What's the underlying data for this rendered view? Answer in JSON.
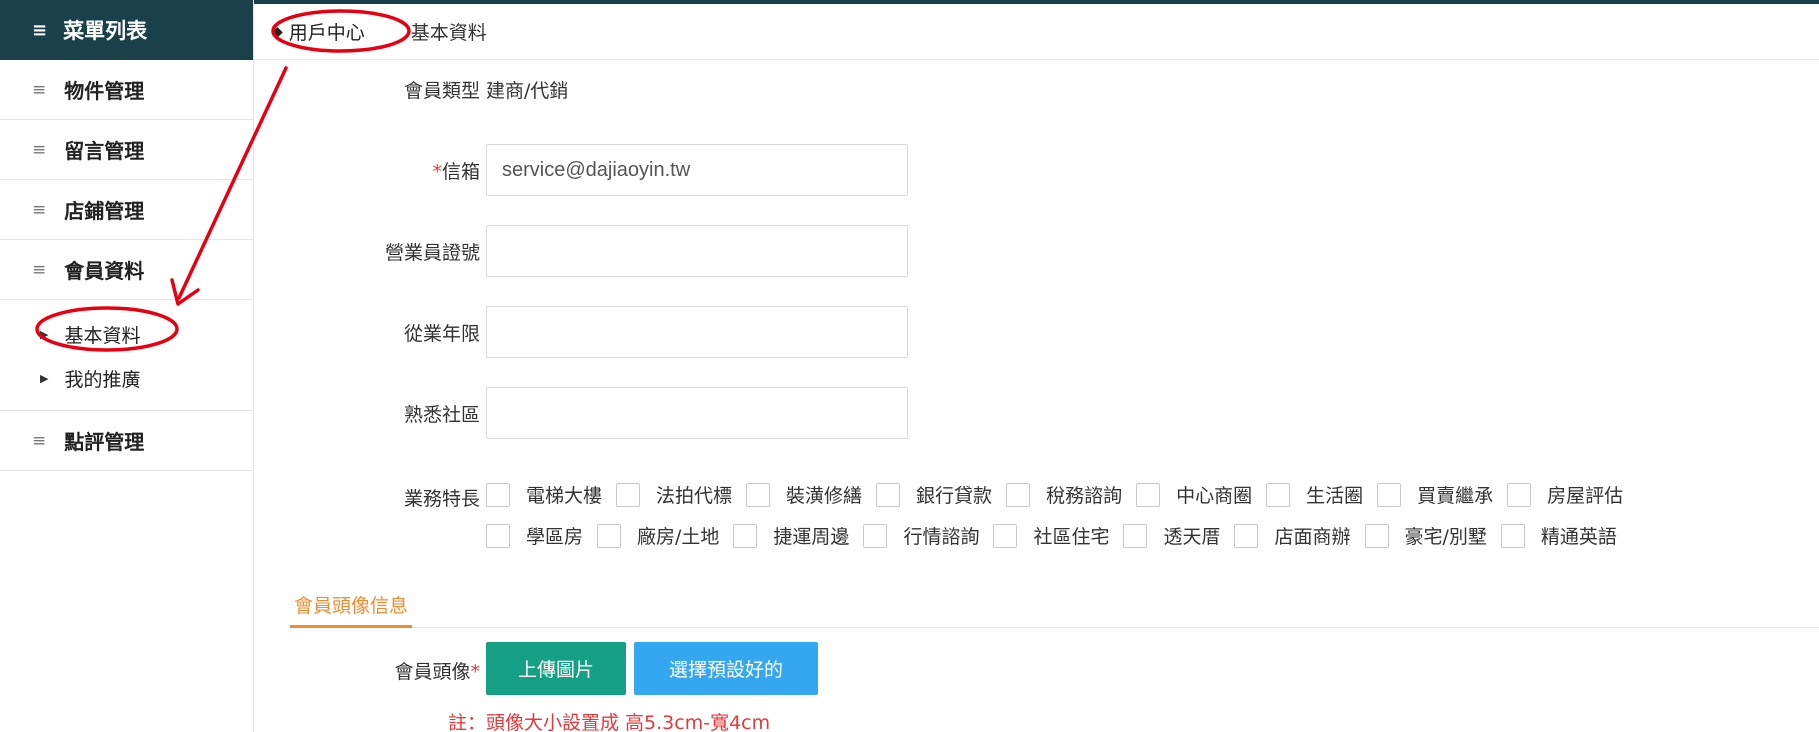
{
  "sidebar": {
    "header": {
      "icon": "list-icon",
      "label": "菜單列表"
    },
    "items": [
      {
        "icon": "list-icon",
        "label": "物件管理"
      },
      {
        "icon": "list-icon",
        "label": "留言管理"
      },
      {
        "icon": "list-icon",
        "label": "店鋪管理"
      },
      {
        "icon": "list-icon",
        "label": "會員資料"
      }
    ],
    "sub_items": [
      {
        "icon": "caret-right-icon",
        "label": "基本資料"
      },
      {
        "icon": "caret-right-icon",
        "label": "我的推廣"
      }
    ],
    "last_item": {
      "icon": "list-icon",
      "label": "點評管理"
    }
  },
  "breadcrumb": {
    "home_icon": "home-icon",
    "home_label": "用戶中心",
    "current": "基本資料"
  },
  "form": {
    "member_type_label": "會員類型",
    "member_type_value": "建商/代銷",
    "email_required": "*",
    "email_label": "信箱",
    "email_value": "service@dajiaoyin.tw",
    "license_label": "營業員證號",
    "license_value": "",
    "years_label": "從業年限",
    "years_value": "",
    "community_label": "熟悉社區",
    "community_value": "",
    "specialty_label": "業務特長",
    "specialties_row1": [
      "電梯大樓",
      "法拍代標",
      "裝潢修繕",
      "銀行貸款",
      "稅務諮詢",
      "中心商圈",
      "生活圈",
      "買賣繼承",
      "房屋評估"
    ],
    "specialties_row2": [
      "學區房",
      "廠房/土地",
      "捷運周邊",
      "行情諮詢",
      "社區住宅",
      "透天厝",
      "店面商辦",
      "豪宅/別墅",
      "精通英語"
    ]
  },
  "avatar_section": {
    "tab_label": "會員頭像信息",
    "avatar_label": "會員頭像",
    "avatar_required": "*",
    "upload_button": "上傳圖片",
    "preset_button": "選擇預設好的",
    "note": "註：頭像大小設置成 高5.3cm-寬4cm"
  },
  "colors": {
    "sidebar_header": "#19404b",
    "active_tab": "#f08c2e",
    "upload_button": "#15a085",
    "preset_button": "#35a6f0",
    "required_mark": "#e4393c",
    "annotation": "#e60012"
  }
}
